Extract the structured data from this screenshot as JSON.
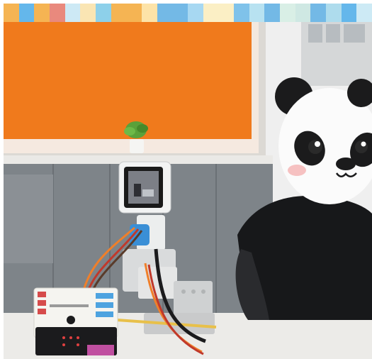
{
  "image": {
    "kind": "photo-frame",
    "description_icons": [
      "panda-mask-icon",
      "plant-icon",
      "robot-screen-icon",
      "microbit-board-icon"
    ],
    "colors": {
      "wall_orange": "#f07a1c",
      "wall_frame": "#f3e8de",
      "cabinet_gray": "#7e8489",
      "desk_white": "#ecebe8",
      "shirt_black": "#17181a",
      "servo_white": "#f2f3f3",
      "blue_block": "#3a8fd6",
      "board_white": "#f5f4f0",
      "board_red": "#d64b4b",
      "board_black": "#1b1b1d",
      "panda_black": "#1b1b1c",
      "panda_white": "#fbfbfb",
      "panda_cheek": "#f4a8a8"
    },
    "strip_colors": [
      "#f5b453",
      "#64b7eb",
      "#f5b453",
      "#e9897d",
      "#cde9f5",
      "#fae5b3",
      "#8dd0ea",
      "#f5b453",
      "#f5b453",
      "#fde3a8",
      "#73b9e6",
      "#73b9e6",
      "#a7d8f2",
      "#fbefc5",
      "#fbefc5",
      "#7fc2ea",
      "#b8e2f1",
      "#73b9e6",
      "#d9efe6",
      "#cfe8e3",
      "#73b9e6",
      "#aedced",
      "#64b7eb",
      "#cdeaf5"
    ]
  }
}
